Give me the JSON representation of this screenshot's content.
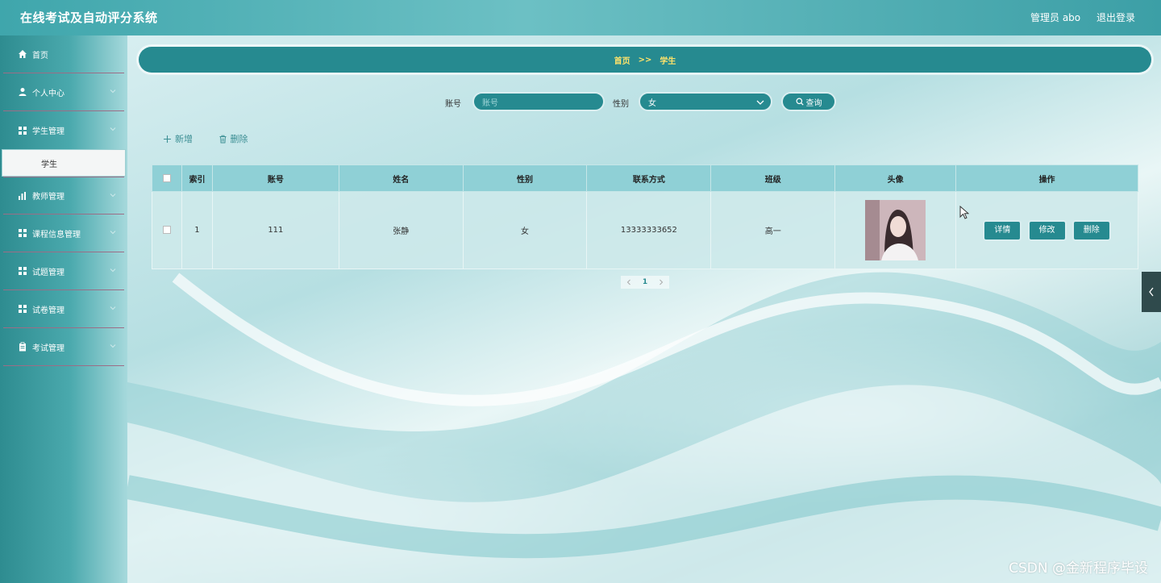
{
  "header": {
    "app_title": "在线考试及自动评分系统",
    "admin_label": "管理员 abo",
    "logout_label": "退出登录"
  },
  "sidebar": {
    "items": [
      {
        "label": "首页",
        "icon": "home-icon"
      },
      {
        "label": "个人中心",
        "icon": "user-icon"
      },
      {
        "label": "学生管理",
        "icon": "grid-icon",
        "submenu": [
          "学生"
        ]
      },
      {
        "label": "教师管理",
        "icon": "chart-icon"
      },
      {
        "label": "课程信息管理",
        "icon": "grid-icon"
      },
      {
        "label": "试题管理",
        "icon": "grid-icon"
      },
      {
        "label": "试卷管理",
        "icon": "grid-icon"
      },
      {
        "label": "考试管理",
        "icon": "clipboard-icon"
      }
    ]
  },
  "breadcrumb": {
    "home": "首页",
    "separator": ">>",
    "current": "学生"
  },
  "search": {
    "account_label": "账号",
    "account_placeholder": "账号",
    "gender_label": "性别",
    "gender_value": "女",
    "query_label": "查询"
  },
  "actions": {
    "add_label": "新增",
    "delete_label": "删除"
  },
  "table": {
    "headers": [
      "索引",
      "账号",
      "姓名",
      "性别",
      "联系方式",
      "班级",
      "头像",
      "操作"
    ],
    "rows": [
      {
        "index": "1",
        "account": "111",
        "name": "张静",
        "gender": "女",
        "phone": "13333333652",
        "class": "高一"
      }
    ],
    "row_buttons": {
      "detail": "详情",
      "edit": "修改",
      "delete": "删除"
    }
  },
  "pagination": {
    "current_page": "1"
  },
  "watermark": "CSDN @金新程序毕设",
  "colors": {
    "primary": "#268a90",
    "breadcrumb_text": "#ffe36a",
    "table_header": "#8fd0d6"
  }
}
